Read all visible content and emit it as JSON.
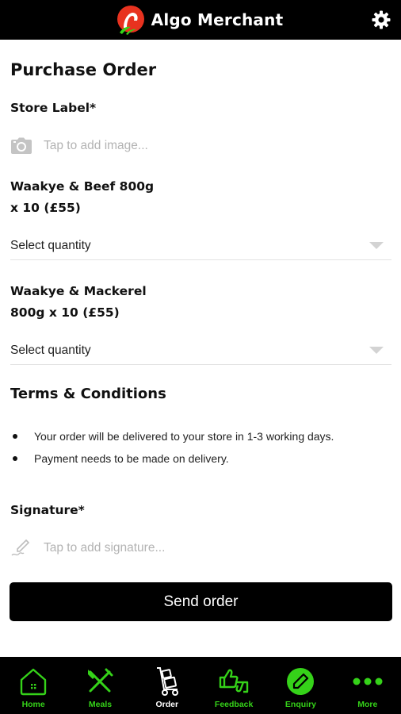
{
  "header": {
    "title": "Algo Merchant",
    "logo_icon": "algo-logo",
    "settings_icon": "gear-icon"
  },
  "form": {
    "title": "Purchase Order",
    "store_label": {
      "label": "Store Label*",
      "placeholder": "Tap to add image...",
      "icon": "camera-icon"
    },
    "products": [
      {
        "name_line1": "Waakye & Beef 800g",
        "name_line2": "x 10 (£55)",
        "select_placeholder": "Select quantity"
      },
      {
        "name_line1": "Waakye & Mackerel",
        "name_line2": "800g x 10 (£55)",
        "select_placeholder": "Select quantity"
      }
    ],
    "terms": {
      "title": "Terms & Conditions",
      "items": [
        "Your order will be delivered to your store in 1-3 working days.",
        "Payment needs to be made on delivery."
      ]
    },
    "signature": {
      "label": "Signature*",
      "placeholder": "Tap to add signature...",
      "icon": "pen-icon"
    },
    "submit_label": "Send order"
  },
  "nav": {
    "items": [
      {
        "label": "Home",
        "icon": "home-icon",
        "active": false
      },
      {
        "label": "Meals",
        "icon": "utensils-icon",
        "active": false
      },
      {
        "label": "Order",
        "icon": "trolley-icon",
        "active": true
      },
      {
        "label": "Feedback",
        "icon": "thumbs-icon",
        "active": false
      },
      {
        "label": "Enquiry",
        "icon": "edit-icon",
        "active": false
      },
      {
        "label": "More",
        "icon": "more-dots-icon",
        "active": false
      }
    ]
  },
  "colors": {
    "brand_green": "#35d219",
    "logo_red": "#e8321f",
    "nav_active": "#ffffff",
    "header_bg": "#000000",
    "placeholder": "#b3b3b3"
  }
}
